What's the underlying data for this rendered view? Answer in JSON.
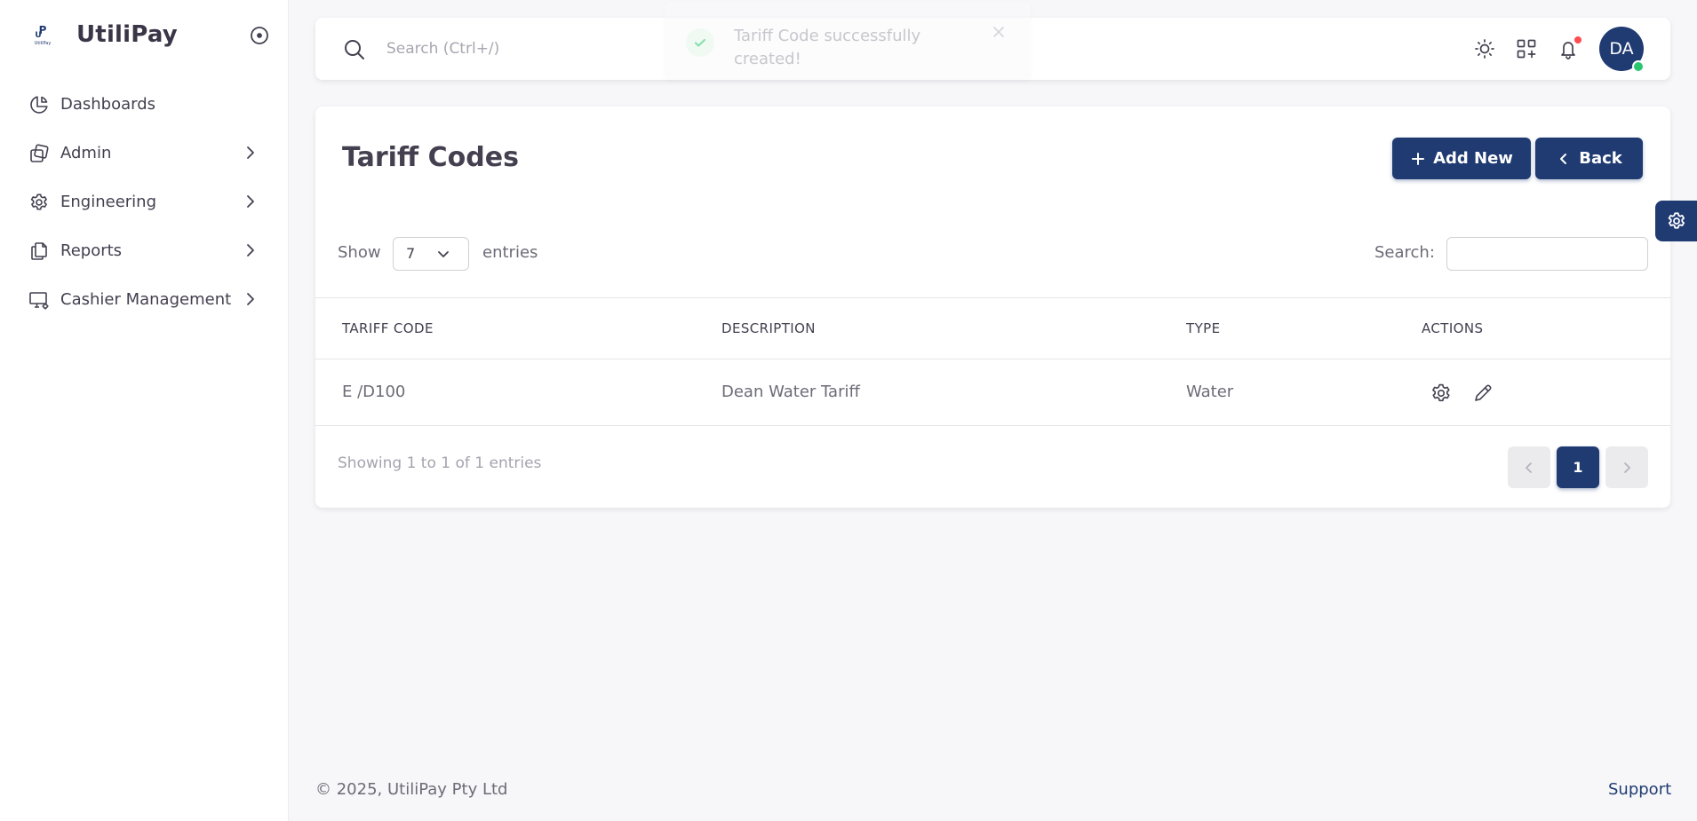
{
  "brand": {
    "name": "UtiliPay",
    "logo_letters": "UP",
    "logo_sub": "UtiliPay"
  },
  "sidebar": {
    "items": [
      {
        "label": "Dashboards",
        "icon": "chart-pie-icon",
        "has_submenu": false
      },
      {
        "label": "Admin",
        "icon": "copy-stack-icon",
        "has_submenu": true
      },
      {
        "label": "Engineering",
        "icon": "gear-icon",
        "has_submenu": true
      },
      {
        "label": "Reports",
        "icon": "files-icon",
        "has_submenu": true
      },
      {
        "label": "Cashier Management",
        "icon": "device-desktop-cog-icon",
        "has_submenu": true
      }
    ]
  },
  "topbar": {
    "search_placeholder": "Search (Ctrl+/)",
    "icons": [
      "sun-icon",
      "apps-grid-plus-icon",
      "bell-icon"
    ],
    "notification_dot": true,
    "avatar_initials": "DA"
  },
  "toast": {
    "message": "Tariff Code successfully created!"
  },
  "page": {
    "title": "Tariff Codes",
    "add_new_label": "Add New",
    "back_label": "Back",
    "show_label": "Show",
    "entries_value": "7",
    "entries_label": "entries",
    "search_label": "Search:",
    "columns": [
      "TARIFF CODE",
      "DESCRIPTION",
      "TYPE",
      "ACTIONS"
    ],
    "rows": [
      {
        "tariff_code": "E /D100",
        "description": "Dean Water Tariff",
        "type": "Water"
      }
    ],
    "info": "Showing 1 to 1 of 1 entries",
    "current_page": "1"
  },
  "footer": {
    "copyright": "© 2025, UtiliPay Pty Ltd",
    "support": "Support"
  },
  "colors": {
    "primary": "#203b72",
    "success": "#28c76f",
    "danger": "#ff4c51",
    "background": "#f7f7f9",
    "text": "#444050",
    "muted": "#6d6b77"
  }
}
